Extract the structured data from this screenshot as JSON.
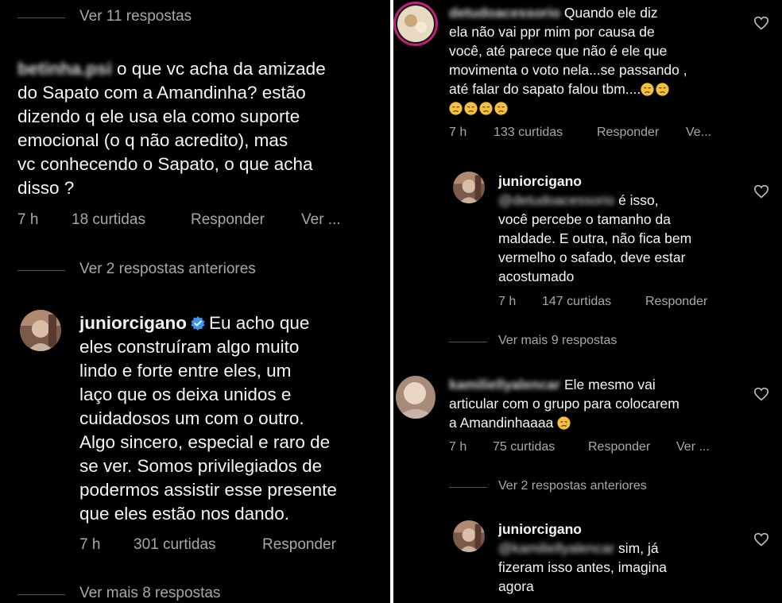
{
  "left": {
    "top_view_replies": "Ver 11 respostas",
    "comment1": {
      "username": "betinha.psi",
      "lines": [
        "o que vc acha da amizade",
        "do Sapato com a Amandinha? estão",
        "dizendo q ele usa ela como suporte",
        "emocional (o q não  acredito), mas",
        "vc conhecendo o Sapato, o que acha",
        "disso ?"
      ],
      "time": "7 h",
      "likes": "18 curtidas",
      "reply": "Responder",
      "translate": "Ver ..."
    },
    "prev_replies": "Ver 2 respostas anteriores",
    "reply1": {
      "username": "juniorcigano",
      "first_line": "Eu acho que",
      "lines": [
        "eles construíram algo muito",
        "lindo e forte entre eles, um",
        "laço que os deixa unidos e",
        "cuidadosos um com o outro.",
        "Algo sincero, especial e raro de",
        "se ver. Somos privilegiados de",
        "podermos assistir esse presente",
        "que eles estão nos dando."
      ],
      "time": "7 h",
      "likes": "301 curtidas",
      "reply": "Responder"
    },
    "more_replies": "Ver mais 8 respostas"
  },
  "right": {
    "comment1": {
      "username": "detudoacessorio",
      "first_line": "Quando ele diz",
      "lines": [
        "ela não vai ppr mim por causa de",
        "você,  até parece que não é ele que",
        "movimenta o voto nela...se passando ,",
        "até falar do sapato falou tbm...."
      ],
      "time": "7 h",
      "likes": "133 curtidas",
      "reply": "Responder",
      "translate": "Ve..."
    },
    "reply1": {
      "username": "juniorcigano",
      "mention": "@detudoacessorio",
      "first_line": "é isso,",
      "lines": [
        "você percebe o tamanho da",
        "maldade. E outra, não fica bem",
        "vermelho o safado, deve estar",
        "acostumado"
      ],
      "time": "7 h",
      "likes": "147 curtidas",
      "reply": "Responder"
    },
    "more_replies": "Ver mais 9 respostas",
    "comment2": {
      "username": "kamiliellyalencar",
      "first_line": "Ele mesmo vai",
      "lines": [
        "articular com o grupo para colocarem",
        "a Amandinhaaaa"
      ],
      "time": "7 h",
      "likes": "75 curtidas",
      "reply": "Responder",
      "translate": "Ver ..."
    },
    "prev_replies": "Ver 2 respostas anteriores",
    "reply2": {
      "username": "juniorcigano",
      "mention": "@kamiliellyalencar",
      "first_line": "sim, já",
      "lines": [
        "fizeram isso antes, imagina",
        "agora"
      ]
    }
  },
  "colors": {
    "background": "#000000",
    "text": "#f5f5f5",
    "secondary_text": "#a8a8a8",
    "verified_blue": "#3897f0",
    "emoji_yellow": "#f7c23a"
  },
  "icons": [
    "heart-outline-icon",
    "verified-badge-icon",
    "disappointed-face-emoji",
    "crying-face-emoji"
  ]
}
